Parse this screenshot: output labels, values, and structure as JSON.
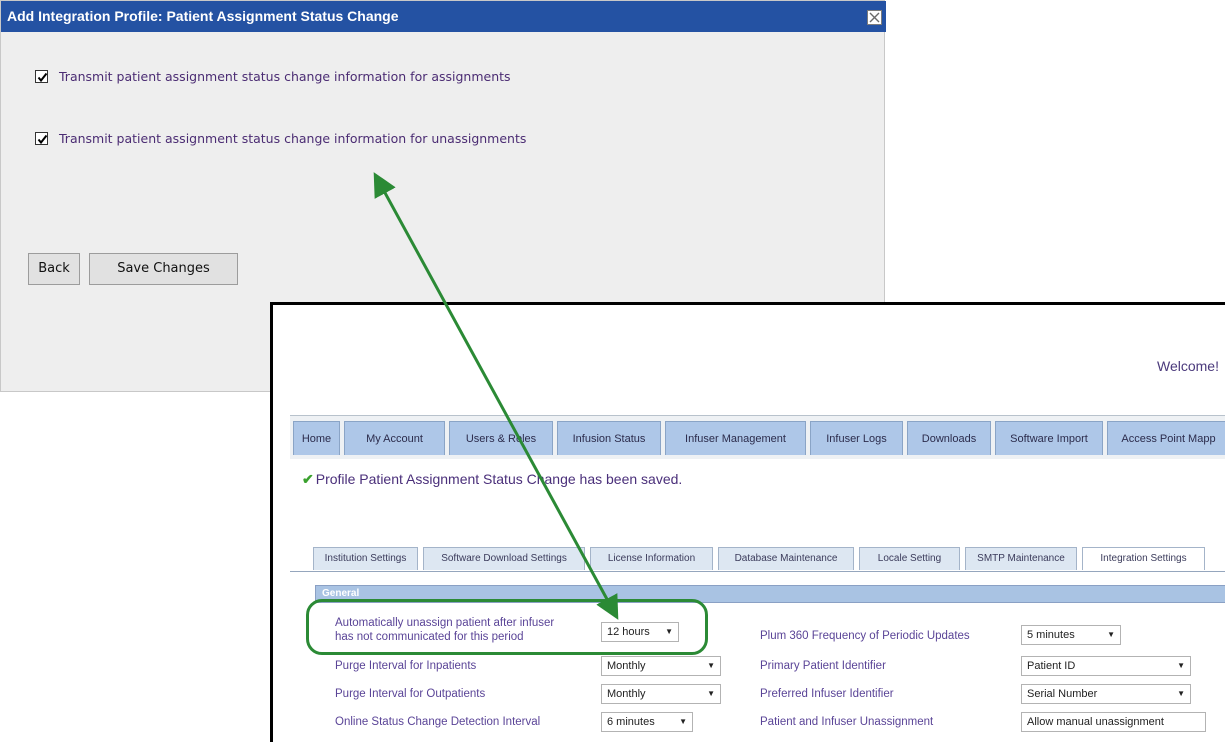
{
  "dialog": {
    "title": "Add Integration Profile: Patient Assignment Status Change",
    "options": [
      {
        "label": "Transmit patient assignment status change information for assignments",
        "checked": true
      },
      {
        "label": "Transmit patient assignment status change information for unassignments",
        "checked": true
      }
    ],
    "back_label": "Back",
    "save_label": "Save Changes"
  },
  "app": {
    "welcome": "Welcome!",
    "main_tabs": [
      "Home",
      "My Account",
      "Users & Roles",
      "Infusion Status",
      "Infuser Management",
      "Infuser Logs",
      "Downloads",
      "Software Import",
      "Access Point Mapp"
    ],
    "saved_message": "Profile Patient Assignment Status Change has been saved.",
    "sub_tabs": [
      "Institution Settings",
      "Software Download Settings",
      "License Information",
      "Database Maintenance",
      "Locale Setting",
      "SMTP Maintenance",
      "Integration Settings"
    ],
    "active_sub_tab": "Integration Settings",
    "section_title": "General",
    "left_fields": [
      {
        "label_line1": "Automatically unassign patient after infuser",
        "label_line2": "has not communicated for this period",
        "value": "12 hours"
      },
      {
        "label": "Purge Interval for Inpatients",
        "value": "Monthly"
      },
      {
        "label": "Purge Interval for Outpatients",
        "value": "Monthly"
      },
      {
        "label": "Online Status Change Detection Interval",
        "value": "6 minutes"
      }
    ],
    "right_fields": [
      {
        "label": "Plum 360 Frequency of Periodic Updates",
        "value": "5 minutes"
      },
      {
        "label": "Primary Patient Identifier",
        "value": "Patient ID"
      },
      {
        "label": "Preferred Infuser Identifier",
        "value": "Serial Number"
      },
      {
        "label": "Patient and Infuser Unassignment",
        "value": "Allow manual unassignment"
      }
    ]
  },
  "annotation": {
    "color": "#2b8a35"
  },
  "colors": {
    "title_bar": "#2452a3",
    "tab": "#aec7e8",
    "label_text": "#5a4497",
    "success": "#3aa12e"
  }
}
